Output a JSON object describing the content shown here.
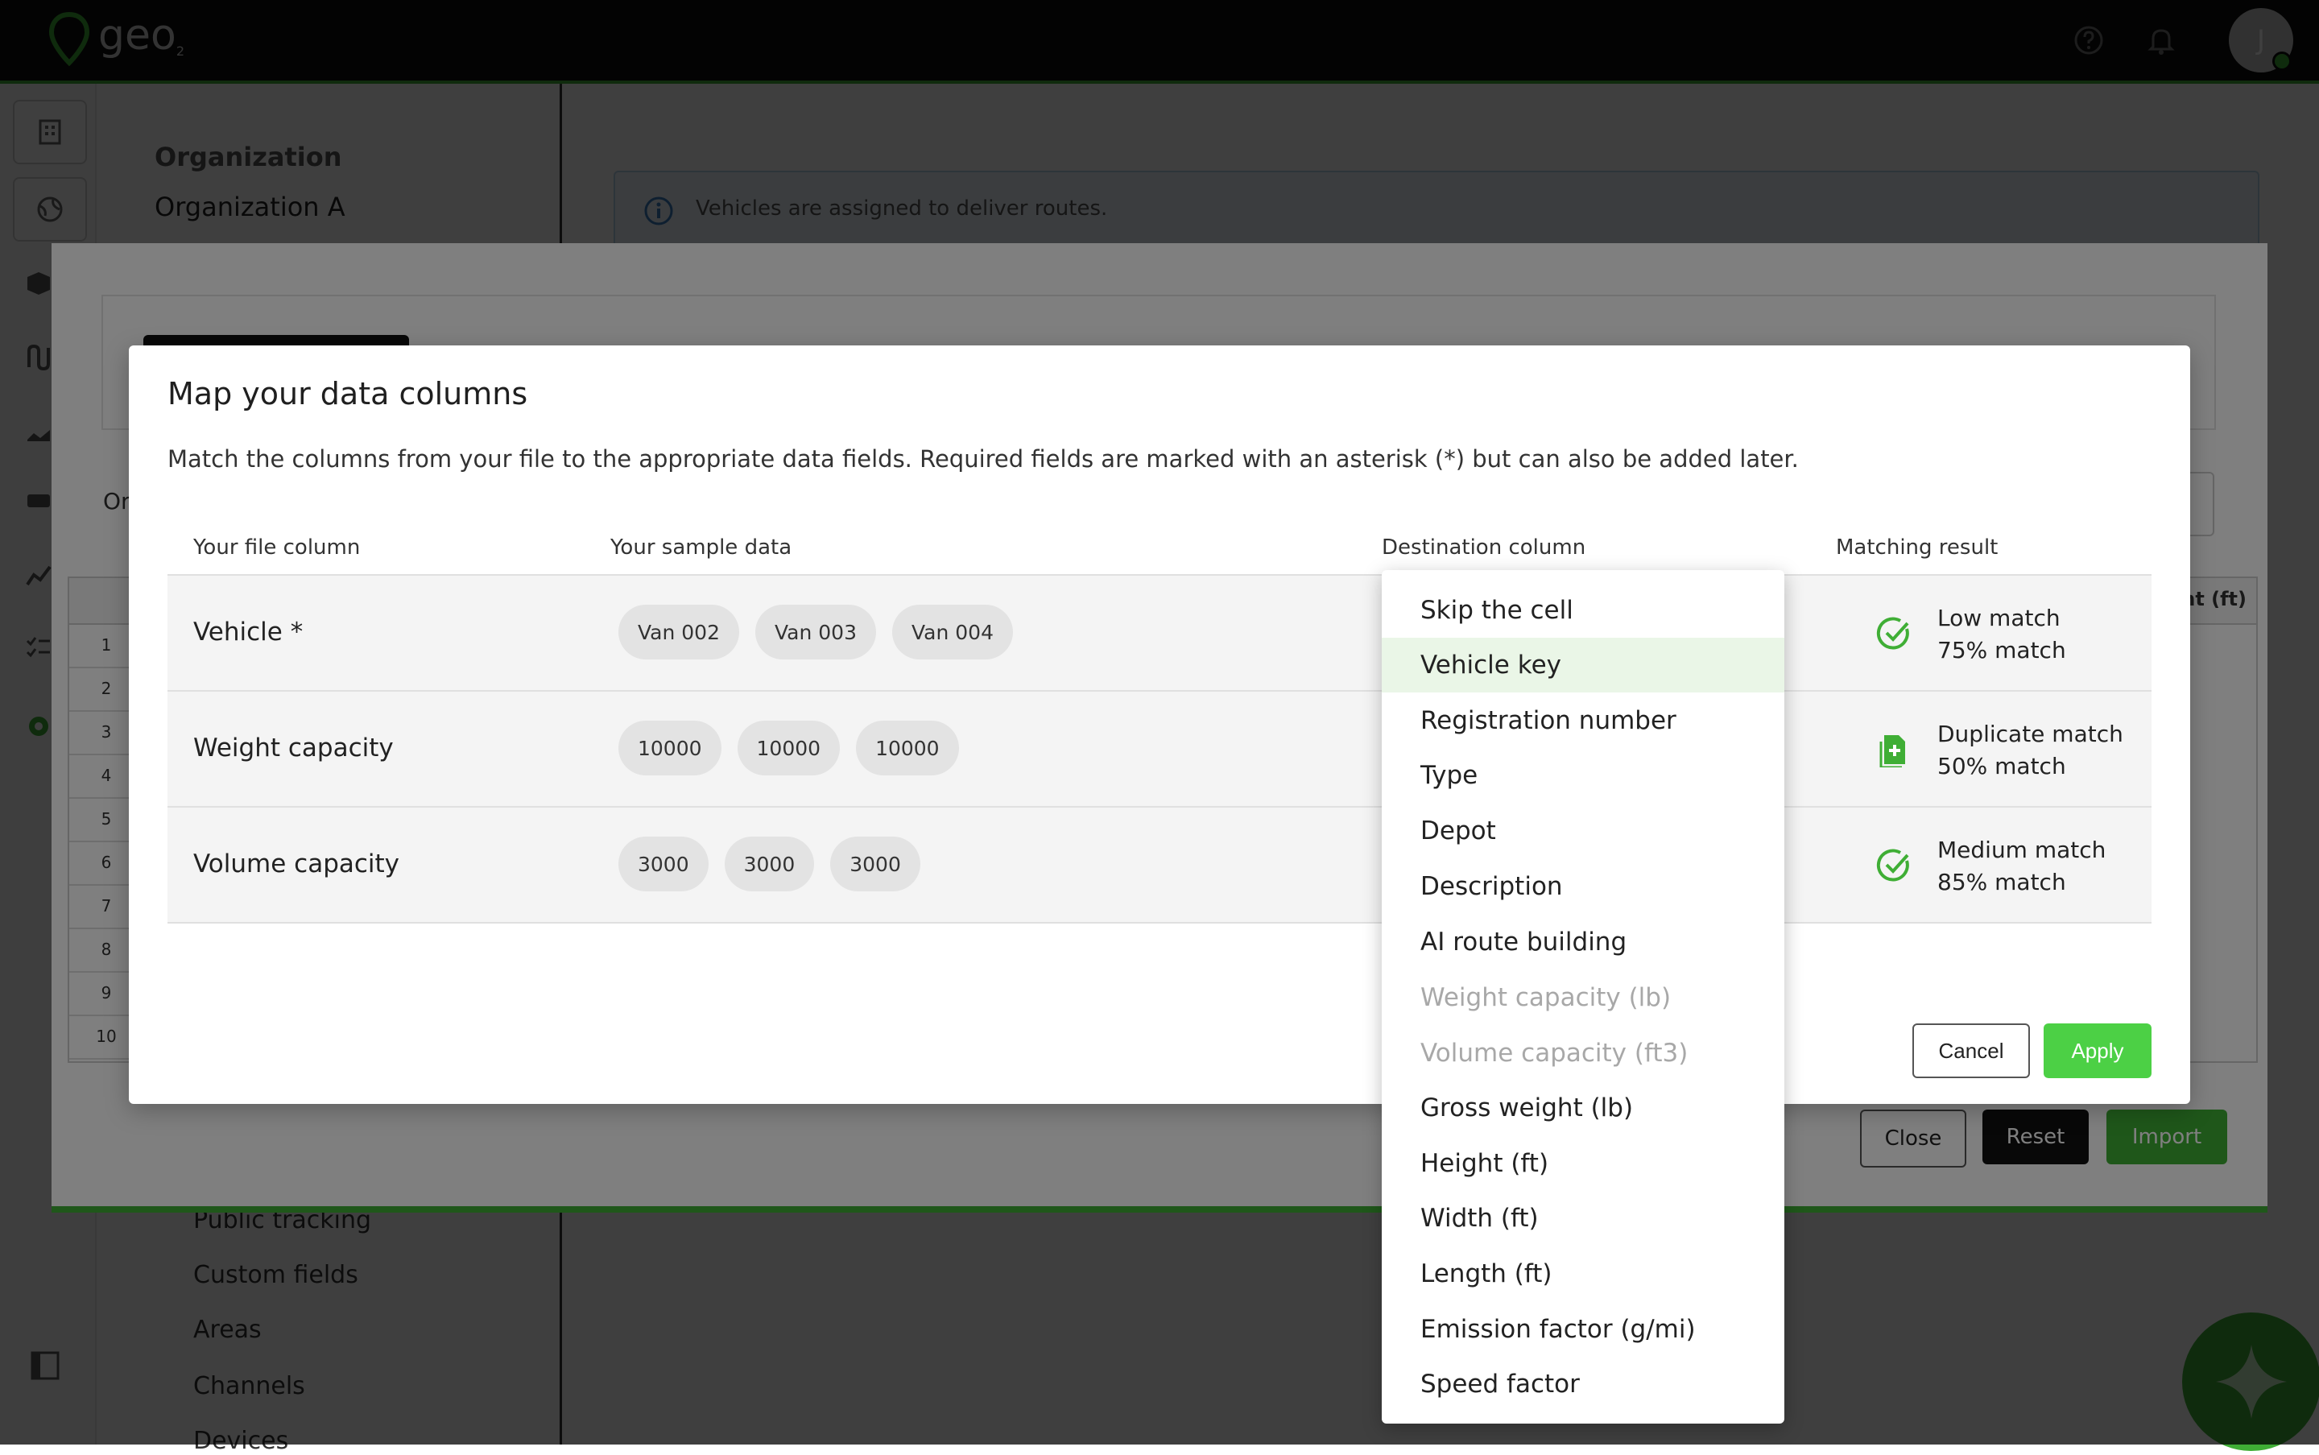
{
  "app": {
    "logo_text": "geo",
    "logo_sub": "2",
    "avatar_initial": "J"
  },
  "settings": {
    "org_heading": "Organization",
    "org_name": "Organization A",
    "nav": [
      "Public tracking",
      "Custom fields",
      "Areas",
      "Channels",
      "Devices"
    ]
  },
  "info_banner": "Vehicles are assigned to deliver routes.",
  "import_modal": {
    "label_partial": "Or",
    "grid_header_partial": "ght (ft)",
    "row_numbers": [
      "1",
      "2",
      "3",
      "4",
      "5",
      "6",
      "7",
      "8",
      "9",
      "10"
    ],
    "close_label": "Close",
    "reset_label": "Reset",
    "import_label": "Import"
  },
  "dialog": {
    "title": "Map your data columns",
    "description": "Match the columns from your file to the appropriate data fields. Required fields are marked with an asterisk (*) but can also be added later.",
    "columns": {
      "file": "Your file column",
      "sample": "Your sample data",
      "destination": "Destination column",
      "result": "Matching result"
    },
    "rows": [
      {
        "file_column": "Vehicle *",
        "samples": [
          "Van 002",
          "Van 003",
          "Van 004"
        ],
        "match_label": "Low match",
        "match_pct": "75% match",
        "icon": "check-circle-icon"
      },
      {
        "file_column": "Weight capacity",
        "samples": [
          "10000",
          "10000",
          "10000"
        ],
        "match_label": "Duplicate match",
        "match_pct": "50% match",
        "icon": "duplicate-file-icon"
      },
      {
        "file_column": "Volume capacity",
        "samples": [
          "3000",
          "3000",
          "3000"
        ],
        "match_label": "Medium match",
        "match_pct": "85% match",
        "icon": "check-circle-icon"
      }
    ],
    "cancel_label": "Cancel",
    "apply_label": "Apply"
  },
  "dropdown": {
    "highlighted": "Vehicle key",
    "options": [
      {
        "label": "Skip the cell",
        "state": "normal"
      },
      {
        "label": "Vehicle key",
        "state": "highlighted"
      },
      {
        "label": "Registration number",
        "state": "normal"
      },
      {
        "label": "Type",
        "state": "normal"
      },
      {
        "label": "Depot",
        "state": "normal"
      },
      {
        "label": "Description",
        "state": "normal"
      },
      {
        "label": "AI route building",
        "state": "normal"
      },
      {
        "label": "Weight capacity (lb)",
        "state": "disabled"
      },
      {
        "label": "Volume capacity (ft3)",
        "state": "disabled"
      },
      {
        "label": "Gross weight (lb)",
        "state": "normal"
      },
      {
        "label": "Height (ft)",
        "state": "normal"
      },
      {
        "label": "Width (ft)",
        "state": "normal"
      },
      {
        "label": "Length (ft)",
        "state": "normal"
      },
      {
        "label": "Emission factor (g/mi)",
        "state": "normal"
      },
      {
        "label": "Speed factor",
        "state": "normal"
      }
    ]
  },
  "colors": {
    "accent": "#3fae35",
    "apply": "#4cd045",
    "highlight": "#eaf6e7"
  }
}
